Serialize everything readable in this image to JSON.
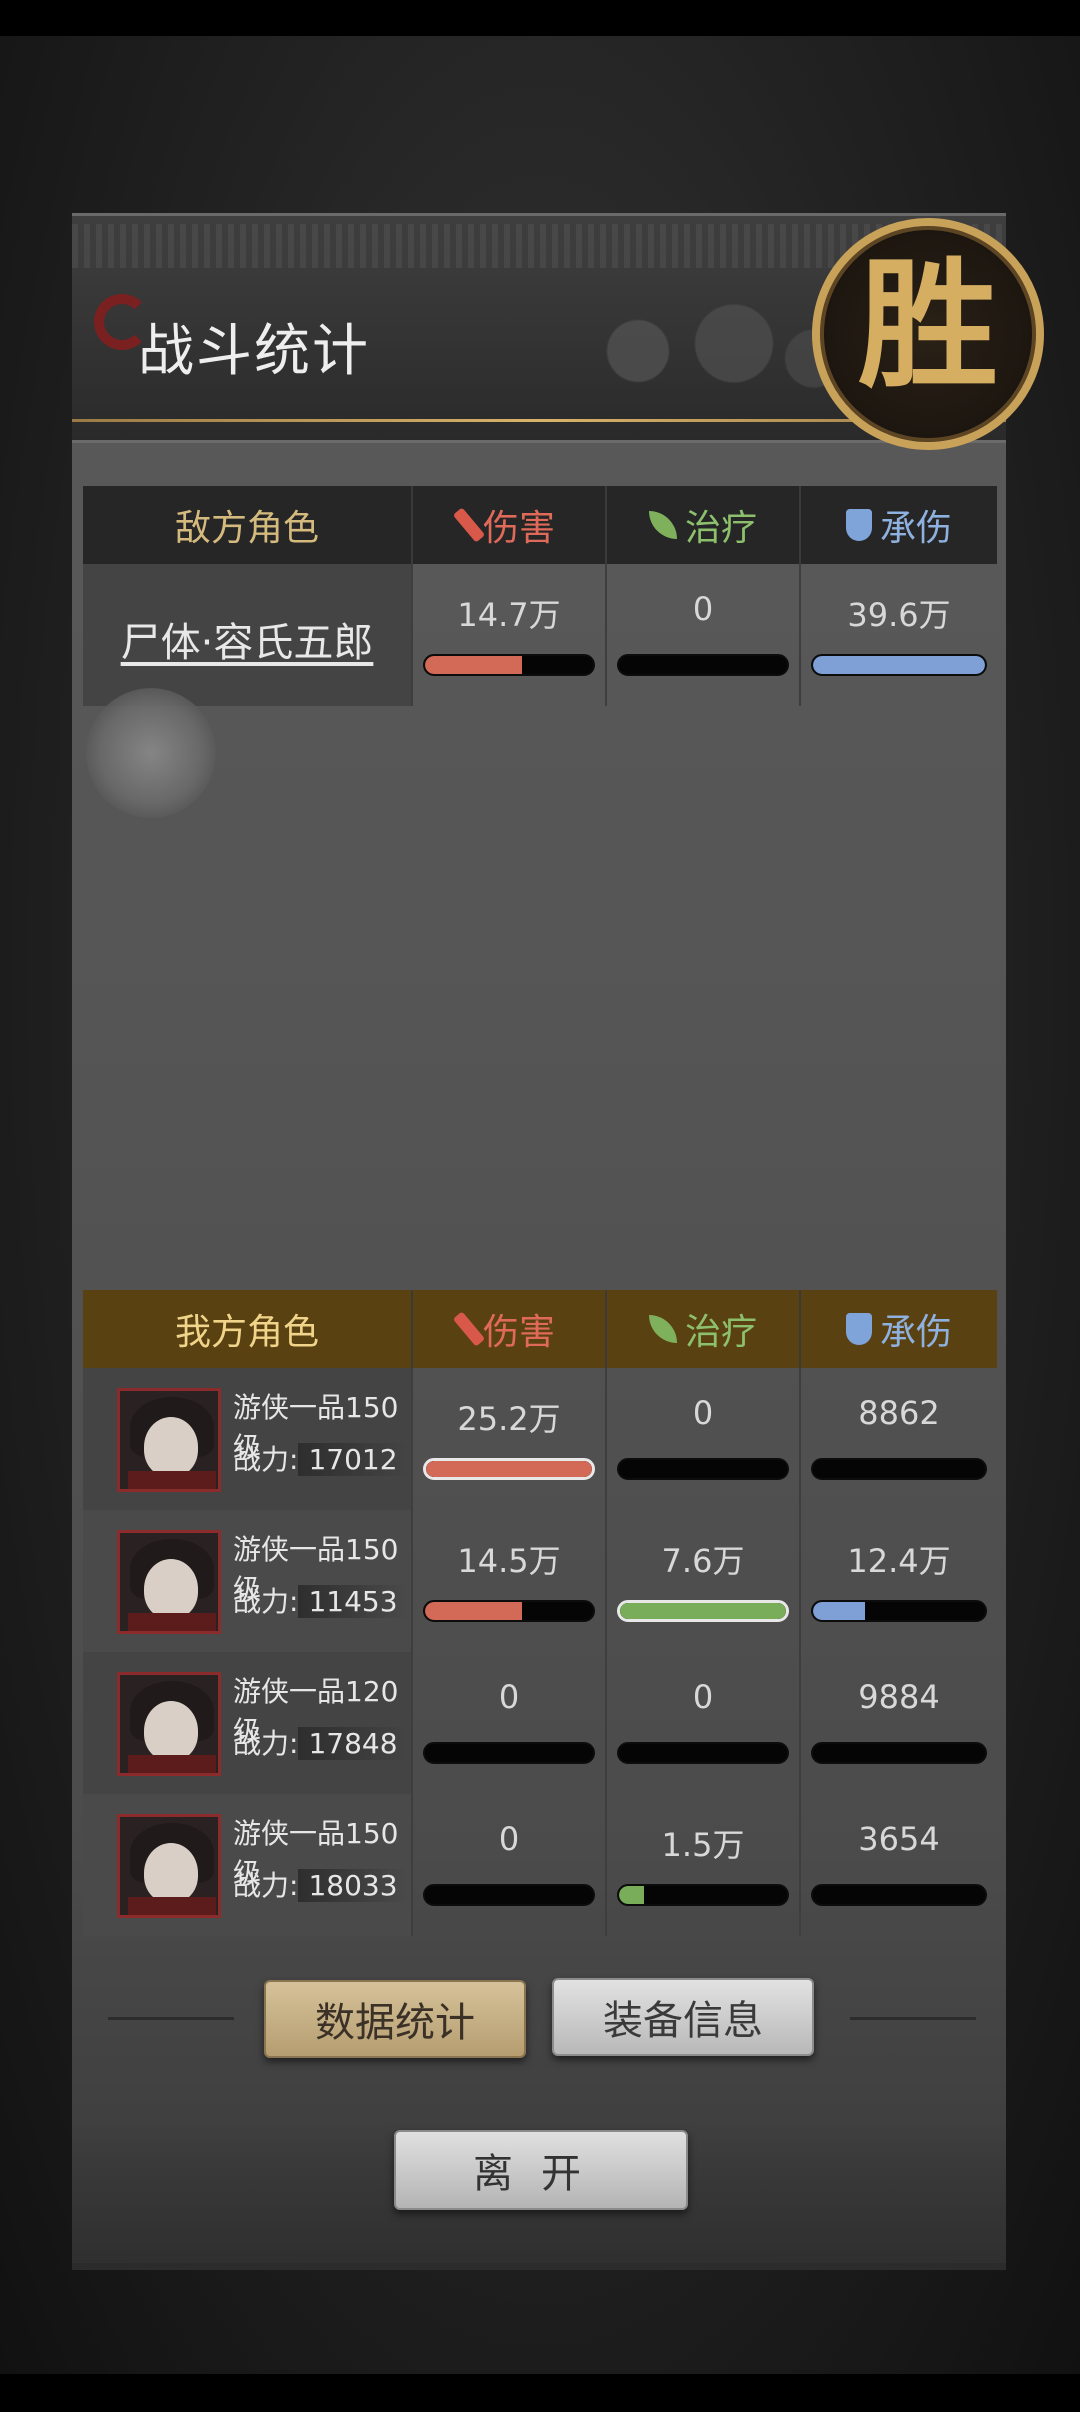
{
  "header": {
    "title": "战斗统计",
    "result_badge": "胜"
  },
  "enemy_table": {
    "title": "敌方角色",
    "columns": {
      "damage": "伤害",
      "heal": "治疗",
      "tank": "承伤"
    },
    "rows": [
      {
        "name": "尸体·容氏五郎",
        "damage": "14.7万",
        "heal": "0",
        "tank": "39.6万",
        "damage_fill": 0.58,
        "heal_fill": 0,
        "tank_fill": 1.0
      }
    ]
  },
  "ally_table": {
    "title": "我方角色",
    "columns": {
      "damage": "伤害",
      "heal": "治疗",
      "tank": "承伤"
    },
    "power_label": "战力:",
    "rows": [
      {
        "class": "游侠一品150级",
        "power": "17012",
        "damage": "25.2万",
        "heal": "0",
        "tank": "8862",
        "damage_fill": 1.0,
        "heal_fill": 0,
        "tank_fill": 0
      },
      {
        "class": "游侠一品150级",
        "power": "11453",
        "damage": "14.5万",
        "heal": "7.6万",
        "tank": "12.4万",
        "damage_fill": 0.58,
        "heal_fill": 1.0,
        "tank_fill": 0.3
      },
      {
        "class": "游侠一品120级",
        "power": "17848",
        "damage": "0",
        "heal": "0",
        "tank": "9884",
        "damage_fill": 0,
        "heal_fill": 0,
        "tank_fill": 0
      },
      {
        "class": "游侠一品150级",
        "power": "18033",
        "damage": "0",
        "heal": "1.5万",
        "tank": "3654",
        "damage_fill": 0,
        "heal_fill": 0.15,
        "tank_fill": 0
      }
    ]
  },
  "buttons": {
    "stats": "数据统计",
    "equipment": "装备信息",
    "leave": "离开"
  },
  "colors": {
    "damage": "#d36a58",
    "heal": "#79ad59",
    "tank": "#7fa0d6",
    "gold": "#d6ae62"
  }
}
